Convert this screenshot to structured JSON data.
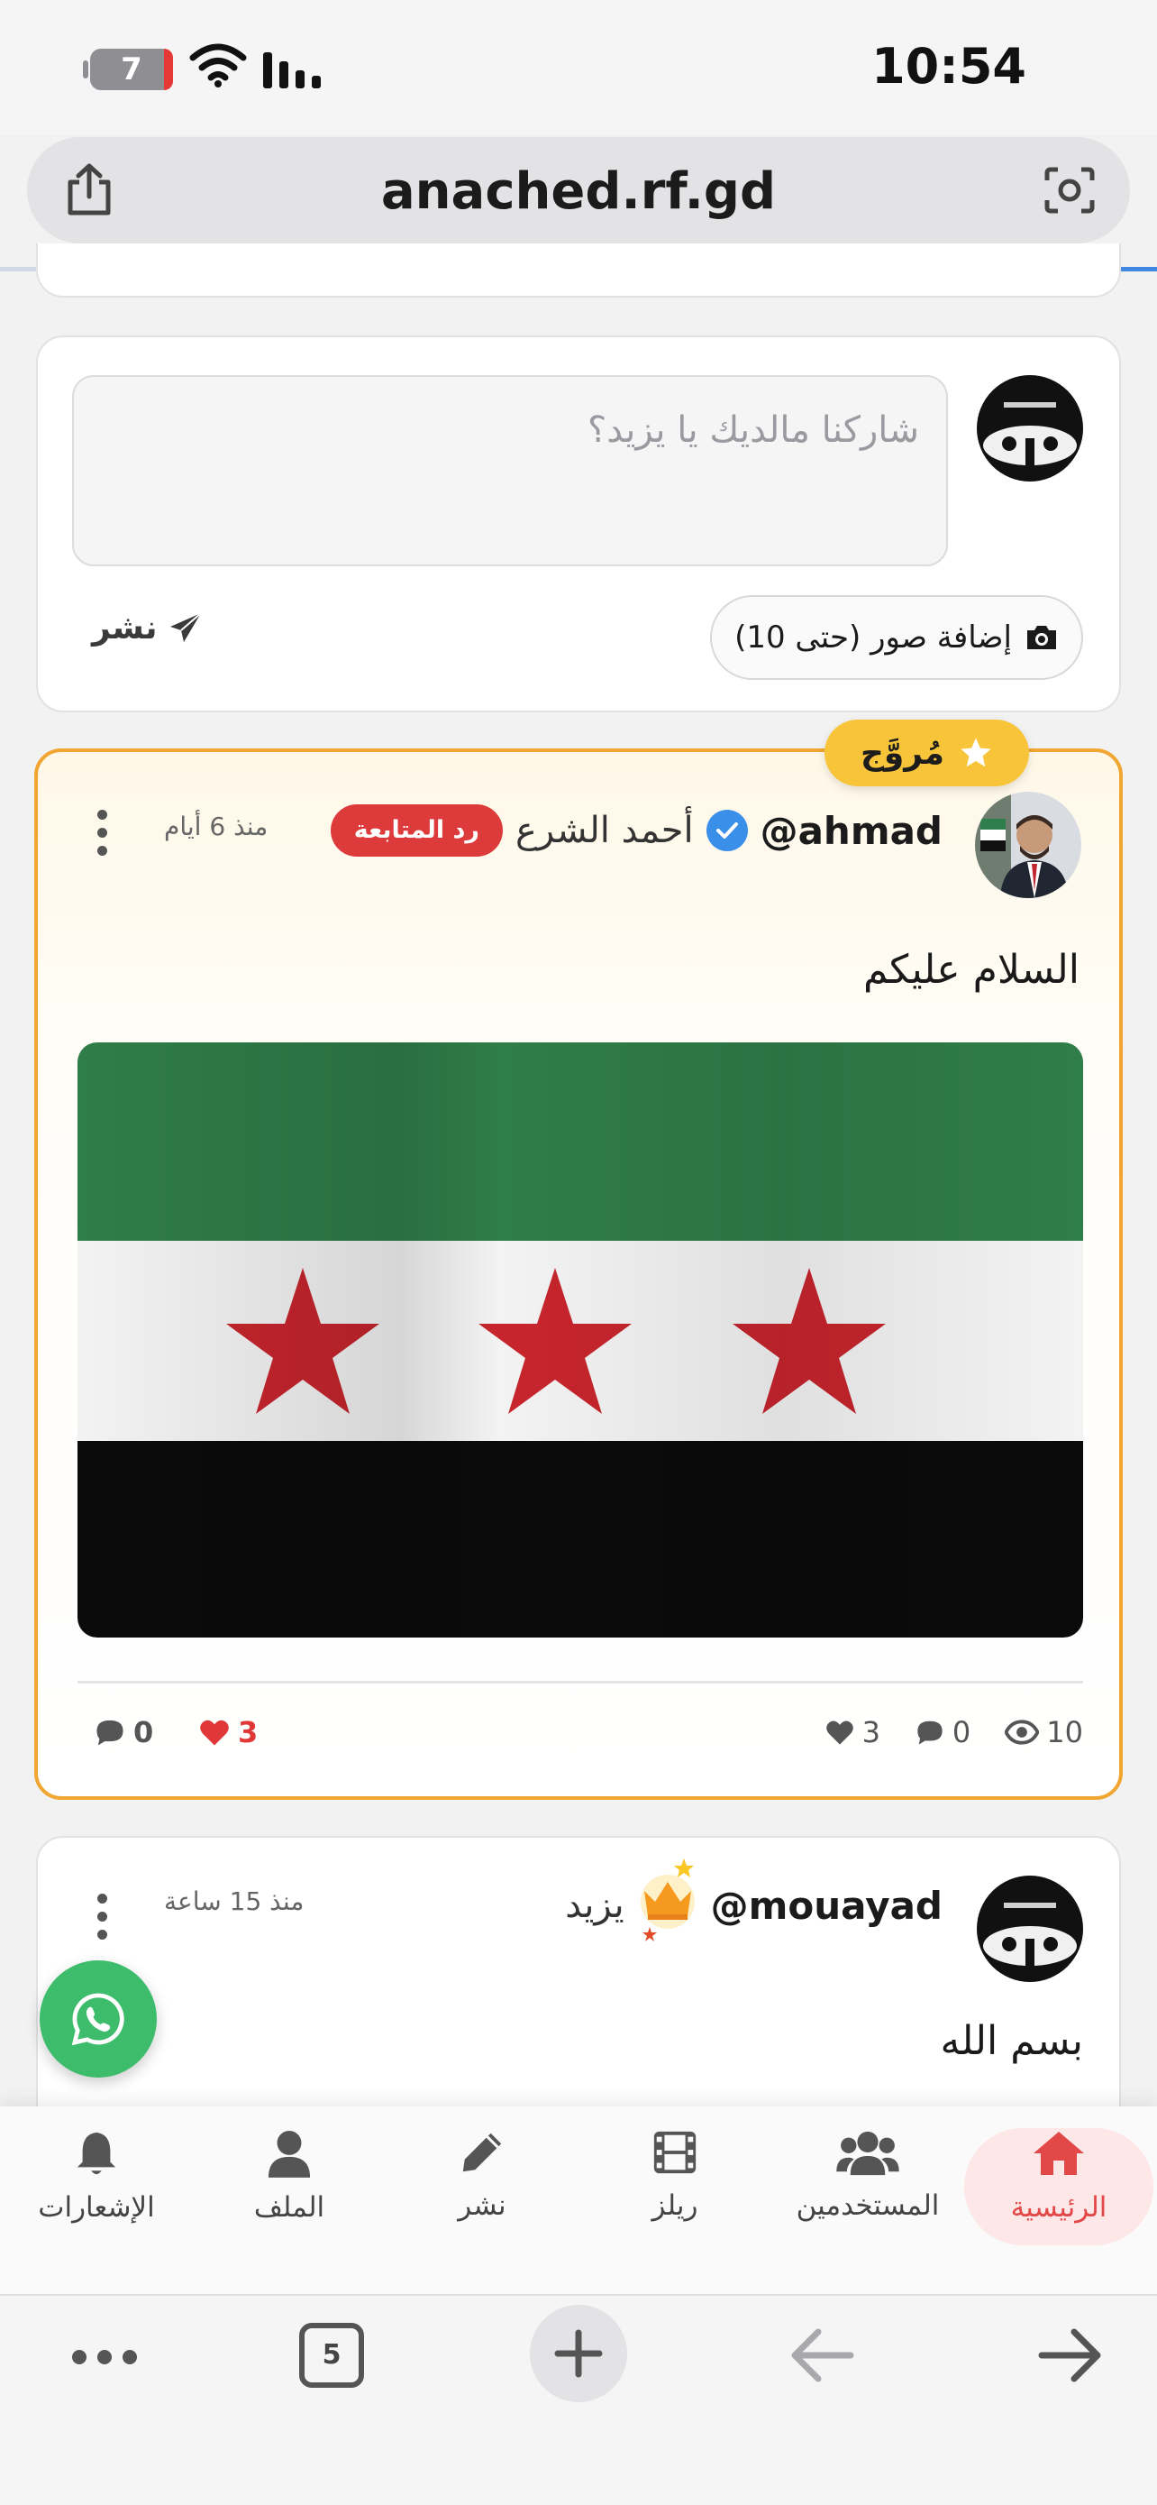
{
  "status_bar": {
    "time": "10:54",
    "battery_level": "7"
  },
  "browser": {
    "url": "anached.rf.gd",
    "tab_count": "5"
  },
  "composer": {
    "placeholder": "شاركنا مالديك يا يزيد؟",
    "add_photos_label": "إضافة صور (حتى 10)",
    "publish_label": "نشر"
  },
  "posts": [
    {
      "badge": "مُروَّج",
      "handle": "@ahmad",
      "display_name": "أحمد الشرع",
      "follow_back_label": "رد المتابعة",
      "time_ago": "منذ 6 أيام",
      "text": "السلام عليكم",
      "stats": {
        "likes": "3",
        "comments": "0",
        "views": "10",
        "my_likes": "3",
        "my_comments": "0"
      }
    },
    {
      "handle": "@mouayad",
      "display_name": "يزيد",
      "time_ago": "منذ 15 ساعة",
      "text": "بسم الله"
    }
  ],
  "bottom_nav": {
    "items": [
      {
        "label": "الرئيسية",
        "icon": "home-icon",
        "active": true
      },
      {
        "label": "المستخدمين",
        "icon": "users-icon"
      },
      {
        "label": "ريلز",
        "icon": "film-icon"
      },
      {
        "label": "نشر",
        "icon": "pencil-icon"
      },
      {
        "label": "الملف",
        "icon": "user-icon"
      },
      {
        "label": "الإشعارات",
        "icon": "bell-icon"
      }
    ]
  },
  "colors": {
    "accent": "#e34848",
    "promo_border": "#f0a630",
    "promo_badge": "#f8c43a",
    "verify": "#3a8fe8",
    "whatsapp": "#3dbd6b",
    "follow_back": "#dd3b3b"
  }
}
